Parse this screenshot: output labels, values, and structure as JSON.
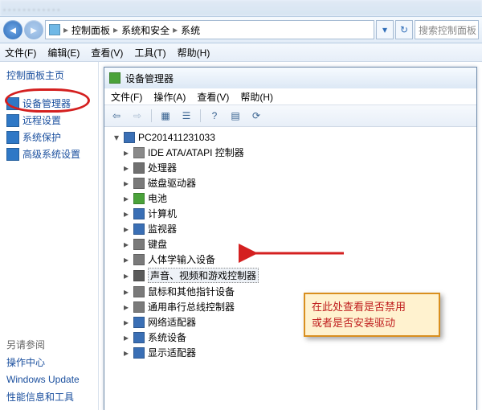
{
  "breadcrumb": {
    "root_icon": "control-panel-icon",
    "items": [
      "控制面板",
      "系统和安全",
      "系统"
    ]
  },
  "search": {
    "placeholder": "搜索控制面板"
  },
  "outer_menu": [
    "文件(F)",
    "编辑(E)",
    "查看(V)",
    "工具(T)",
    "帮助(H)"
  ],
  "sidebar": {
    "title": "控制面板主页",
    "items": [
      {
        "label": "设备管理器",
        "icon": "#2f78c6",
        "highlighted": true
      },
      {
        "label": "远程设置",
        "icon": "#2f78c6"
      },
      {
        "label": "系统保护",
        "icon": "#2f78c6"
      },
      {
        "label": "高级系统设置",
        "icon": "#2f78c6"
      }
    ],
    "see_also_title": "另请参阅",
    "see_also": [
      "操作中心",
      "Windows Update",
      "性能信息和工具"
    ]
  },
  "dm": {
    "title": "设备管理器",
    "menu": [
      "文件(F)",
      "操作(A)",
      "查看(V)",
      "帮助(H)"
    ],
    "root": "PC201411231033",
    "nodes": [
      {
        "label": "IDE ATA/ATAPI 控制器",
        "color": "#8a8a8a"
      },
      {
        "label": "处理器",
        "color": "#707070"
      },
      {
        "label": "磁盘驱动器",
        "color": "#7a7a7a"
      },
      {
        "label": "电池",
        "color": "#4aa23a"
      },
      {
        "label": "计算机",
        "color": "#3a6fb5"
      },
      {
        "label": "监视器",
        "color": "#3a6fb5"
      },
      {
        "label": "键盘",
        "color": "#7a7a7a"
      },
      {
        "label": "人体学输入设备",
        "color": "#7a7a7a"
      },
      {
        "label": "声音、视频和游戏控制器",
        "color": "#5a5a5a",
        "selected": true
      },
      {
        "label": "鼠标和其他指针设备",
        "color": "#7a7a7a"
      },
      {
        "label": "通用串行总线控制器",
        "color": "#7a7a7a"
      },
      {
        "label": "网络适配器",
        "color": "#3a6fb5"
      },
      {
        "label": "系统设备",
        "color": "#3a6fb5"
      },
      {
        "label": "显示适配器",
        "color": "#3a6fb5"
      }
    ]
  },
  "callout": {
    "line1": "在此处查看是否禁用",
    "line2": "或者是否安装驱动"
  }
}
